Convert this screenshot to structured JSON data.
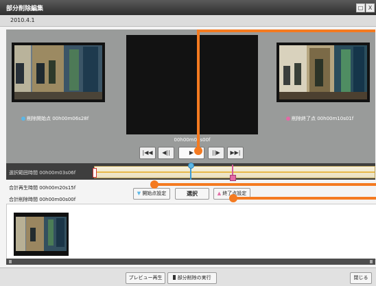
{
  "window": {
    "title": "部分削除編集",
    "restore_symbol": "□",
    "close_symbol": "X",
    "date": "2010.4.1"
  },
  "preview": {
    "start_caption": "削除開始点 00h00m06s28f",
    "end_caption": "削除終了点 00h00m10s01f",
    "timecode": "00h00m08s00f",
    "start_marker_color": "#5bb7e6",
    "end_marker_color": "#e36aa5"
  },
  "controls": [
    {
      "name": "skip-to-start-button",
      "icon": "skip-start-icon",
      "symbol": "|◀◀"
    },
    {
      "name": "step-back-button",
      "icon": "step-back-icon",
      "symbol": "◀||"
    },
    {
      "name": "play-button",
      "icon": "play-icon",
      "symbol": "▶"
    },
    {
      "name": "step-forward-button",
      "icon": "step-forward-icon",
      "symbol": "||▶"
    },
    {
      "name": "skip-to-end-button",
      "icon": "skip-end-icon",
      "symbol": "▶▶|"
    }
  ],
  "range": {
    "label": "選択範囲時間",
    "value": "00h00m03s06f",
    "start_fraction": 0.34,
    "end_fraction": 0.49
  },
  "info": {
    "total_play_label": "合計再生時間",
    "total_play_value": "00h00m20s15f",
    "total_delete_label": "合計削除時間",
    "total_delete_value": "00h00m00s00f"
  },
  "buttons": {
    "set_start": "開始点設定",
    "select": "選択",
    "set_end": "終了点設定"
  },
  "footer": {
    "preview_play": "プレビュー再生",
    "execute_delete": "部分削除の実行",
    "close": "閉じる"
  },
  "colors": {
    "callout": "#f47a20",
    "stage_bg": "#999b9a",
    "titlebar": "#3a3a3a"
  }
}
